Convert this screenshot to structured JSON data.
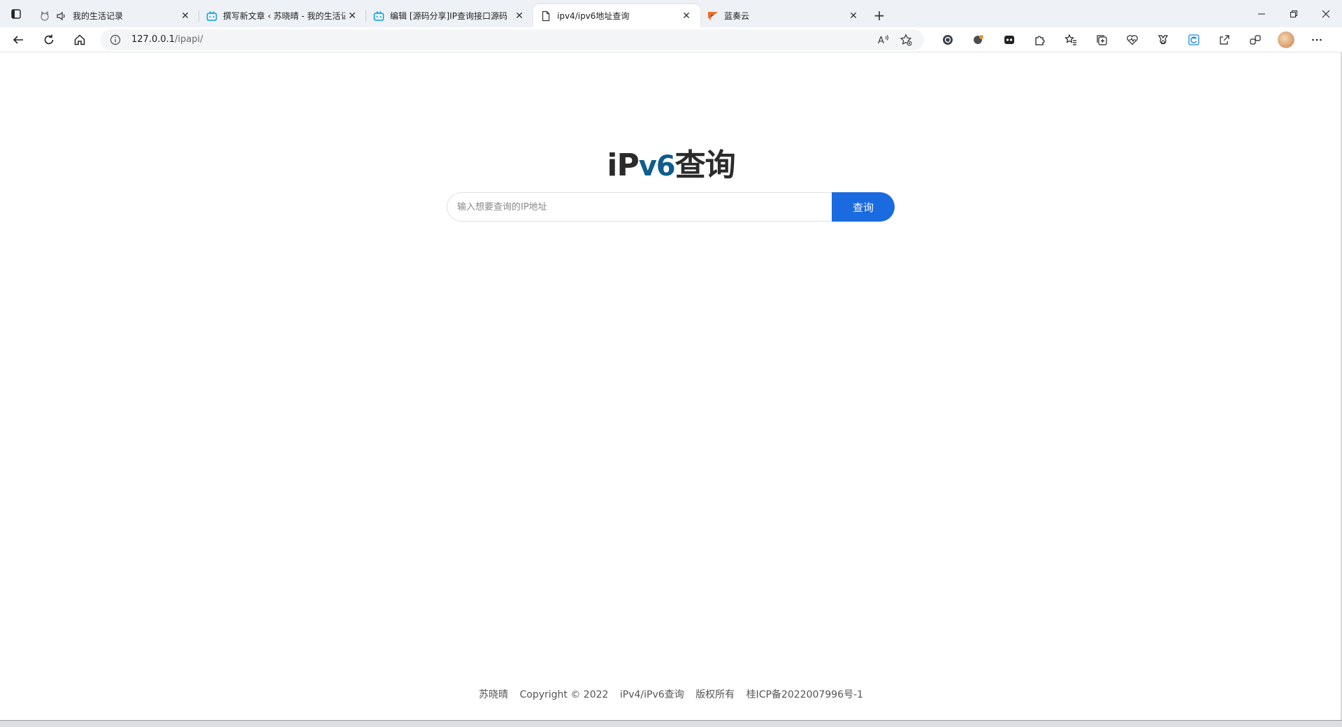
{
  "browser": {
    "tabs": [
      {
        "title": "我的生活记录",
        "favicon": "cat-icon",
        "muted": true,
        "active": false
      },
      {
        "title": "撰写新文章 ‹ 苏晓晴 - 我的生活记录",
        "favicon": "bilibili-icon",
        "active": false
      },
      {
        "title": "编辑 [源码分享]IP查询接口源码",
        "favicon": "bilibili-icon",
        "active": false
      },
      {
        "title": "ipv4/ipv6地址查询",
        "favicon": "page-icon",
        "active": true
      },
      {
        "title": "蓝奏云",
        "favicon": "lanzou-icon",
        "active": false
      }
    ],
    "new_tab_label": "+",
    "address": {
      "host": "127.0.0.1",
      "path": "/ipapi/"
    }
  },
  "page": {
    "logo": {
      "prefix": "iP",
      "brand": "v6",
      "suffix": "查询"
    },
    "search": {
      "placeholder": "输入想要查询的IP地址",
      "value": "",
      "button_label": "查询"
    },
    "footer": {
      "author": "苏晓晴",
      "copyright": "Copyright © 2022",
      "site": "iPv4/iPv6查询",
      "rights": "版权所有",
      "icp": "桂ICP备2022007996号-1"
    }
  },
  "colors": {
    "accent": "#1a6ae0",
    "logo_brand": "#0e5d8c"
  }
}
